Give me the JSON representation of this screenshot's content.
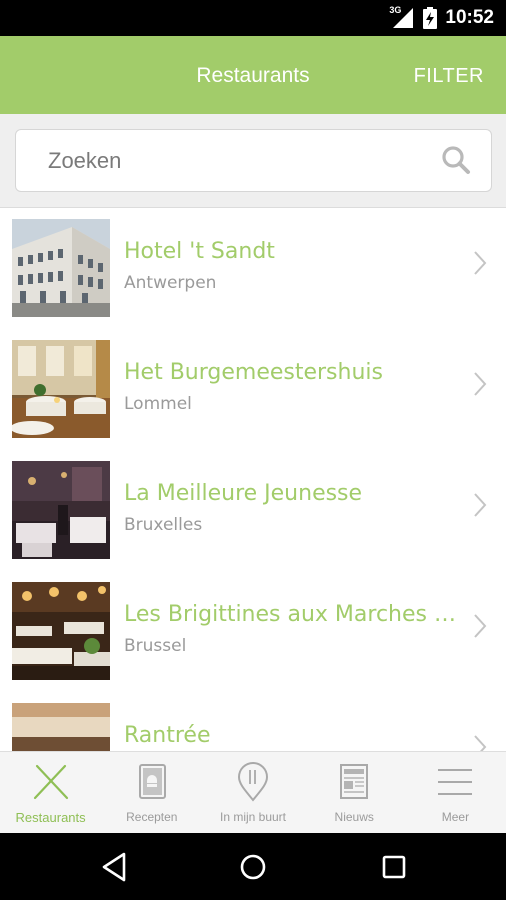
{
  "status_bar": {
    "network": "3G",
    "time": "10:52"
  },
  "app_bar": {
    "title": "Restaurants",
    "filter_label": "FILTER",
    "accent_color": "#a2cc6a"
  },
  "search": {
    "placeholder": "Zoeken",
    "value": ""
  },
  "restaurants": [
    {
      "name": "Hotel 't Sandt",
      "city": "Antwerpen"
    },
    {
      "name": "Het Burgemeestershuis",
      "city": "Lommel"
    },
    {
      "name": "La Meilleure Jeunesse",
      "city": "Bruxelles"
    },
    {
      "name": "Les Brigittines aux Marches de...",
      "city": "Brussel"
    },
    {
      "name": "Rantrée",
      "city": ""
    }
  ],
  "tabs": [
    {
      "label": "Restaurants",
      "icon": "fork-knife-icon",
      "active": true
    },
    {
      "label": "Recepten",
      "icon": "recipe-book-icon",
      "active": false
    },
    {
      "label": "In mijn buurt",
      "icon": "location-pin-icon",
      "active": false
    },
    {
      "label": "Nieuws",
      "icon": "news-icon",
      "active": false
    },
    {
      "label": "Meer",
      "icon": "menu-icon",
      "active": false
    }
  ],
  "nav_bar": {
    "back": "back-icon",
    "home": "home-icon",
    "recents": "recents-icon"
  }
}
